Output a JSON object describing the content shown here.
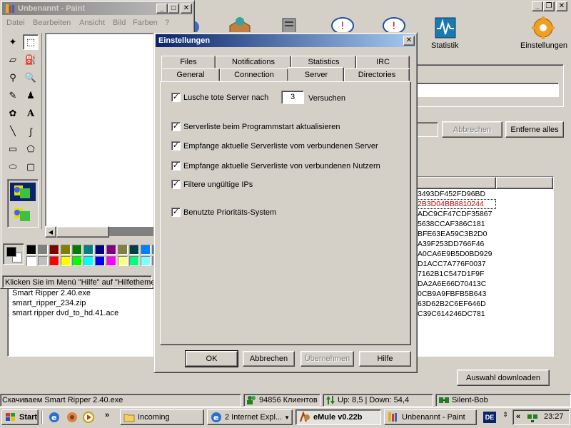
{
  "emule_window": {
    "toolbar": {
      "statistik_label": "Statistik",
      "einstellungen_label": "Einstellungen"
    },
    "search_buttons": {
      "abbrechen": "Abbrechen",
      "entferne_alles": "Entferne alles"
    },
    "file_list": [
      "Smart Ripper 2.40.exe",
      "smart_ripper_234.zip",
      "smart ripper dvd_to_hd.41.ace"
    ],
    "hashes": [
      "3493DF452FD96BD",
      "2B3D04BB8810244",
      "ADC9CF47CDF35867",
      "5638CCAF386C181",
      "BFE63EA59C3B2D0",
      "A39F253DD766F46",
      "A0CA6E9B5D0BD929",
      "D1ACC7A776F0037",
      "7162B1C547D1F9F",
      "DA2A6E66D70413C",
      "0CB9A9FBFB5B643",
      "63D62B2C6EF646D",
      "C39C614246DC781"
    ],
    "highlight_color": "#cc0000",
    "download_button": "Auswahl downloaden",
    "statusbar": {
      "message": "Скачиваем Smart Ripper 2.40.exe",
      "clients": "94856 Клиентов",
      "traffic": "Up: 8,5 | Down: 54,4",
      "server": "Silent-Bob"
    }
  },
  "paint_window": {
    "title": "Unbenannt - Paint",
    "menu": [
      "Datei",
      "Bearbeiten",
      "Ansicht",
      "Bild",
      "Farben",
      "?"
    ],
    "status_text": "Klicken Sie im Menü \"Hilfe\" auf \"Hilfethemen\"",
    "palette": [
      "#000000",
      "#808080",
      "#800000",
      "#808000",
      "#008000",
      "#008080",
      "#000080",
      "#800080",
      "#808040",
      "#004040",
      "#0080ff",
      "#004080",
      "#ffffff",
      "#c0c0c0",
      "#ff0000",
      "#ffff00",
      "#00ff00",
      "#00ffff",
      "#0000ff",
      "#ff00ff",
      "#ffff80",
      "#00ff80",
      "#80ffff",
      "#8080ff"
    ]
  },
  "dialog": {
    "title": "Einstellungen",
    "tabs_back": [
      "Files",
      "Notifications",
      "Statistics",
      "IRC"
    ],
    "tabs_front": [
      "General",
      "Connection",
      "Server",
      "Directories"
    ],
    "active_tab": "Server",
    "remove_dead_label": "Lusche tote Server nach",
    "remove_dead_value": "3",
    "remove_dead_suffix": "Versuchen",
    "options": [
      "Serverliste beim Programmstart aktualisieren",
      "Empfange aktuelle Serverliste vom verbundenen Server",
      "Empfange aktuelle Serverliste von verbundenen Nutzern",
      "Filtere ungültige IPs",
      "Benutzte Prioritäts-System"
    ],
    "buttons": {
      "ok": "OK",
      "cancel": "Abbrechen",
      "apply": "Übernehmen",
      "help": "Hilfe"
    }
  },
  "taskbar": {
    "start": "Start",
    "chevron": "»",
    "tasks": [
      "Incoming",
      "2 Internet Expl...",
      "eMule v0.22b",
      "Unbenannt - Paint"
    ],
    "lang": "DE",
    "tray_chevron": "«",
    "clock": "23:27"
  }
}
